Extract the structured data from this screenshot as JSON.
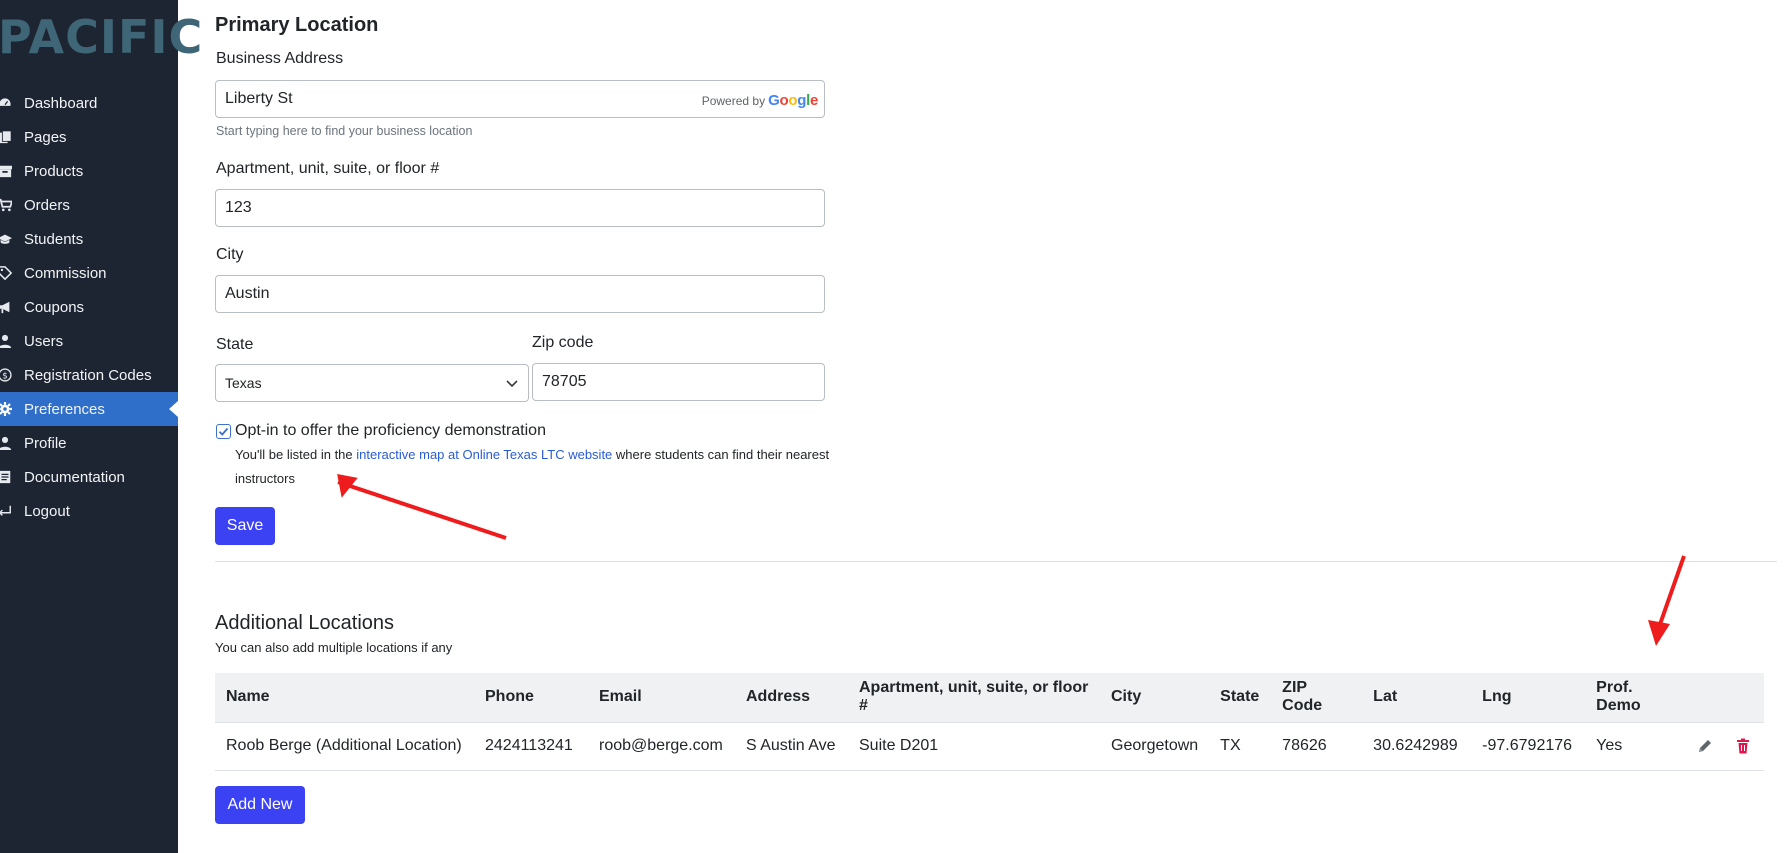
{
  "brand": {
    "logo": "PACIFIC"
  },
  "sidebar": {
    "items": [
      {
        "label": "Dashboard",
        "icon": "dashboard-icon"
      },
      {
        "label": "Pages",
        "icon": "pages-icon"
      },
      {
        "label": "Products",
        "icon": "products-icon"
      },
      {
        "label": "Orders",
        "icon": "cart-icon"
      },
      {
        "label": "Students",
        "icon": "graduation-cap-icon"
      },
      {
        "label": "Commission",
        "icon": "tags-icon"
      },
      {
        "label": "Coupons",
        "icon": "megaphone-icon"
      },
      {
        "label": "Users",
        "icon": "user-icon"
      },
      {
        "label": "Registration Codes",
        "icon": "dollar-circle-icon"
      },
      {
        "label": "Preferences",
        "icon": "gear-icon",
        "active": true
      },
      {
        "label": "Profile",
        "icon": "user-icon"
      },
      {
        "label": "Documentation",
        "icon": "document-icon"
      },
      {
        "label": "Logout",
        "icon": "logout-icon"
      }
    ]
  },
  "primary": {
    "title": "Primary Location",
    "address_label": "Business Address",
    "address_value": "Liberty St",
    "powered_by": "Powered by",
    "google": [
      "G",
      "o",
      "o",
      "g",
      "l",
      "e"
    ],
    "address_hint": "Start typing here to find your business location",
    "apt_label": "Apartment, unit, suite, or floor #",
    "apt_value": "123",
    "city_label": "City",
    "city_value": "Austin",
    "state_label": "State",
    "state_value": "Texas",
    "zip_label": "Zip code",
    "zip_value": "78705",
    "optin_label": "Opt-in to offer the proficiency demonstration",
    "optin_checked": true,
    "optin_note_pre": "You'll be listed in the ",
    "optin_note_link": "interactive map at Online Texas LTC website",
    "optin_note_post": " where students can find their nearest instructors",
    "save": "Save"
  },
  "additional": {
    "title": "Additional Locations",
    "subtitle": "You can also add multiple locations if any",
    "columns": [
      "Name",
      "Phone",
      "Email",
      "Address",
      "Apartment, unit, suite, or floor #",
      "City",
      "State",
      "ZIP Code",
      "Lat",
      "Lng",
      "Prof. Demo"
    ],
    "rows": [
      [
        "Roob Berge (Additional Location)",
        "2424113241",
        "roob@berge.com",
        "S Austin Ave",
        "Suite D201",
        "Georgetown",
        "TX",
        "78626",
        "30.6242989",
        "-97.6792176",
        "Yes"
      ]
    ],
    "add_new": "Add New"
  },
  "colors": {
    "sidebar_bg": "#1e2532",
    "active_bg": "#2f6fc9",
    "primary_button": "#3b42f4",
    "link": "#2a5bd7",
    "annotation_arrow": "#ee1c1c",
    "delete_icon": "#e0174a"
  }
}
